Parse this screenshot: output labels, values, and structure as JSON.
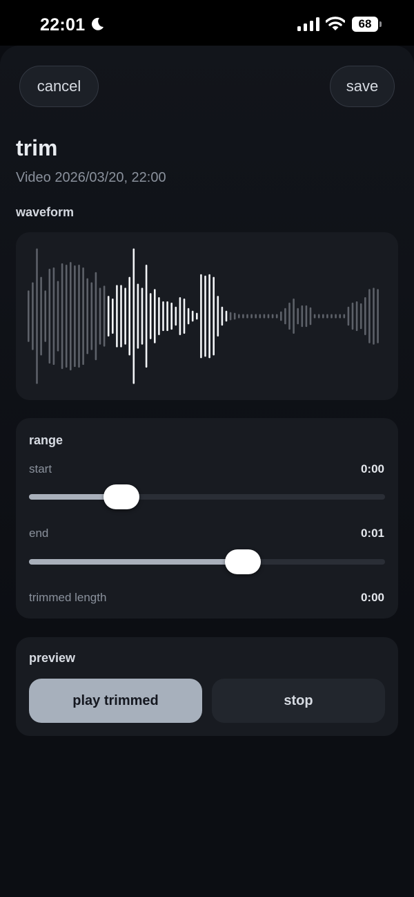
{
  "status_bar": {
    "time": "22:01",
    "battery": "68",
    "icons": [
      "moon-icon",
      "cellular-signal-icon",
      "wifi-icon",
      "battery-icon"
    ]
  },
  "header": {
    "cancel_label": "cancel",
    "save_label": "save"
  },
  "title": "trim",
  "subtitle": "Video 2026/03/20, 22:00",
  "waveform": {
    "label": "waveform",
    "selected_start_fraction": 0.23,
    "selected_end_fraction": 0.58,
    "colors": {
      "selected": "#f2f4f7",
      "unselected": "#5d6169"
    }
  },
  "range": {
    "title": "range",
    "start_label": "start",
    "start_value": "0:00",
    "start_position_fraction": 0.26,
    "end_label": "end",
    "end_value": "0:01",
    "end_position_fraction": 0.6,
    "trimmed_length_label": "trimmed length",
    "trimmed_length_value": "0:00"
  },
  "preview": {
    "title": "preview",
    "play_label": "play trimmed",
    "stop_label": "stop"
  },
  "colors": {
    "background": "#0b0d12",
    "card": "#181b21",
    "accent_button": "#a7b0bc"
  }
}
